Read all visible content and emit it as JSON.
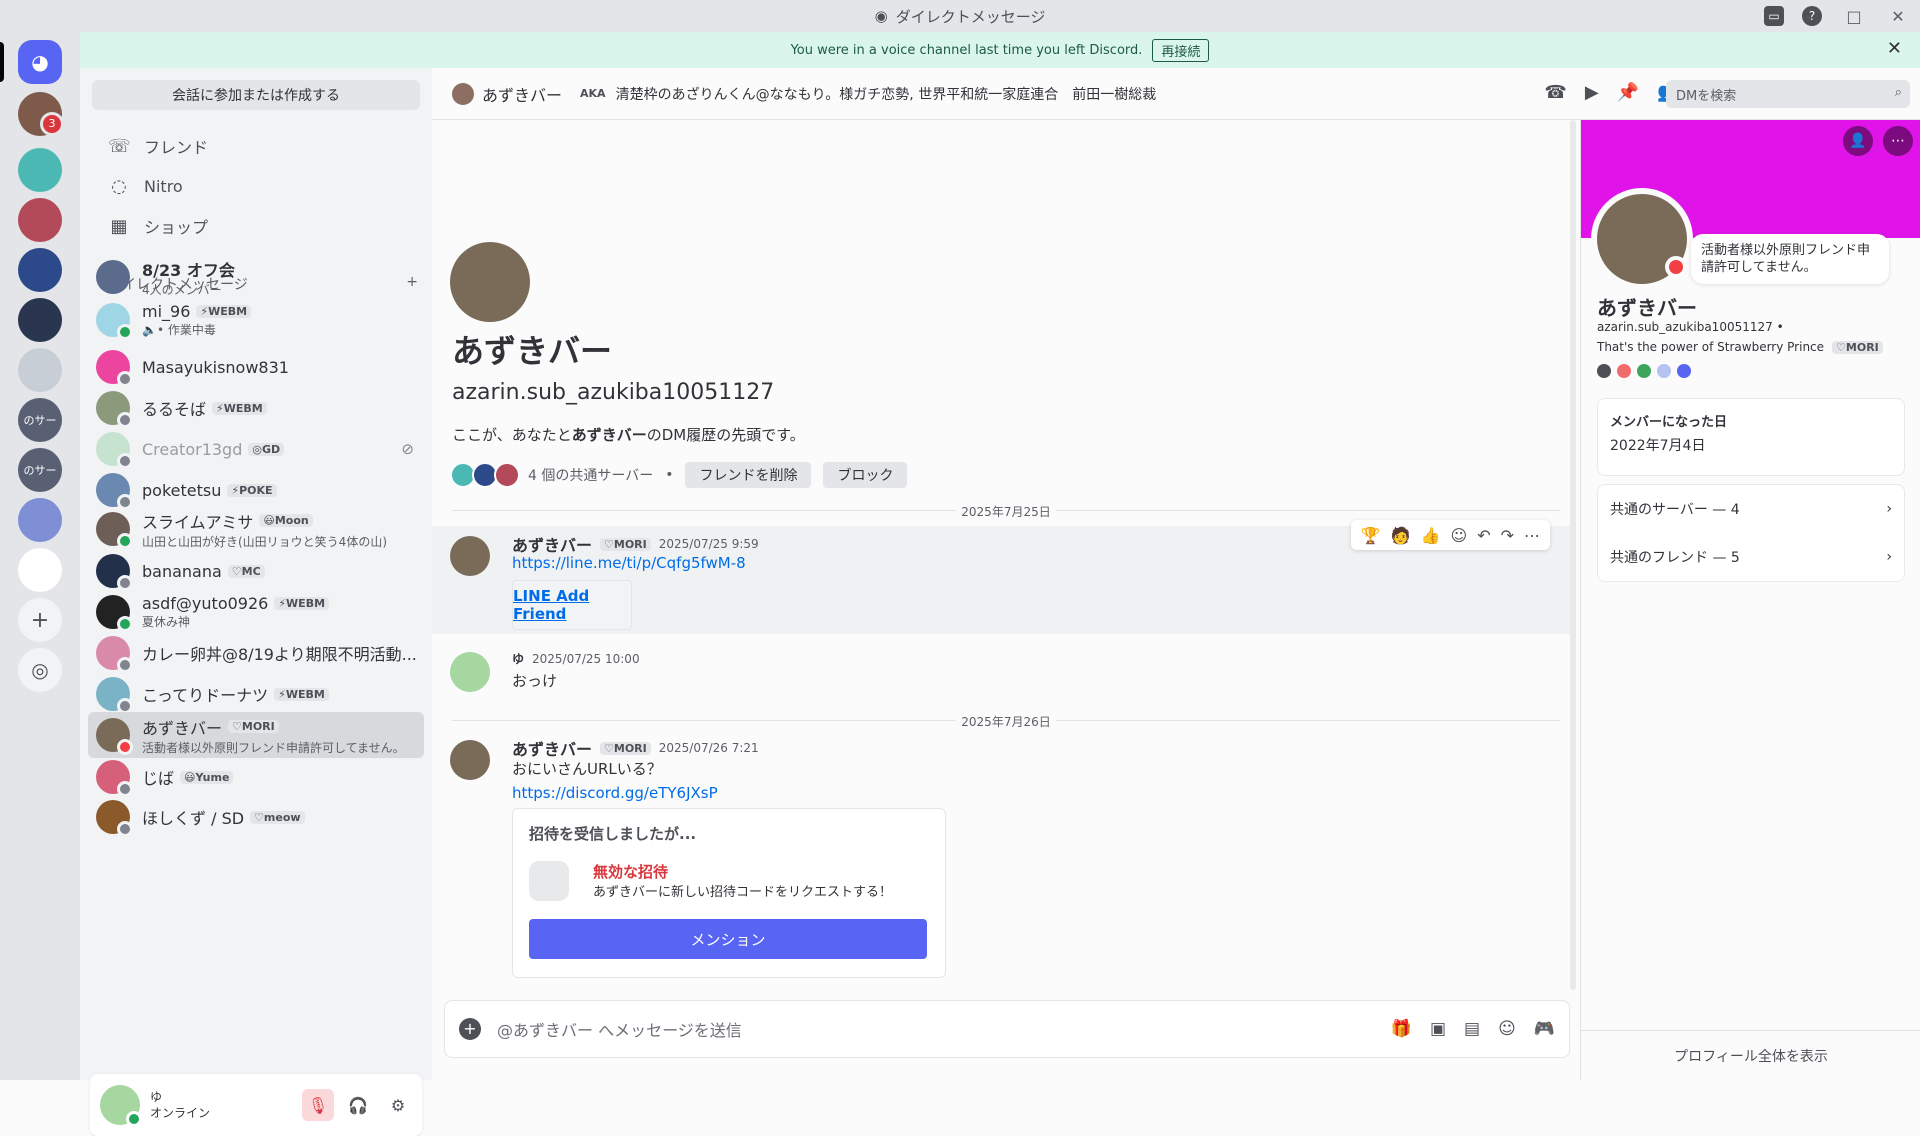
{
  "window": {
    "title": "ダイレクトメッセージ"
  },
  "banner": {
    "text": "You were in a voice channel last time you left Discord.",
    "reconnect": "再接続"
  },
  "sidebar": {
    "search_placeholder": "会話に参加または作成する",
    "nav": [
      {
        "label": "フレンド",
        "icon": "friends-icon"
      },
      {
        "label": "Nitro",
        "icon": "nitro-icon"
      },
      {
        "label": "ショップ",
        "icon": "shop-icon"
      }
    ],
    "dm_header": "ダイレクトメッセージ",
    "dms": [
      {
        "name": "8/23 オフ会",
        "sub": "4人のメンバー",
        "tag": "",
        "status": "",
        "color": "#5b6b8c"
      },
      {
        "name": "mi_96",
        "sub": "🔈• 作業中毒",
        "tag": "⚡WEBM",
        "status": "on",
        "color": "#9fd6e6"
      },
      {
        "name": "Masayukisnow831",
        "sub": "",
        "tag": "",
        "status": "off",
        "color": "#eb459f"
      },
      {
        "name": "るるそば",
        "sub": "",
        "tag": "⚡WEBM",
        "status": "off",
        "color": "#8b9a7a"
      },
      {
        "name": "Creator13gd",
        "sub": "",
        "tag": "◎GD",
        "status": "off",
        "color": "#c6e3cf"
      },
      {
        "name": "poketetsu",
        "sub": "",
        "tag": "⚡POKE",
        "status": "off",
        "color": "#6a88b0"
      },
      {
        "name": "スライムアミサ",
        "sub": "山田と山田が好き(山田リョウと笑う4体の山)",
        "tag": "😃Moon",
        "status": "on",
        "color": "#6d5e58"
      },
      {
        "name": "bananana",
        "sub": "",
        "tag": "♡MC",
        "status": "off",
        "color": "#23304a"
      },
      {
        "name": "asdf@yuto0926",
        "sub": "夏休み神",
        "tag": "⚡WEBM",
        "status": "on",
        "color": "#222222"
      },
      {
        "name": "カレー卵丼@8/19より期限不明活動...",
        "sub": "",
        "tag": "",
        "status": "off",
        "color": "#d98aa8"
      },
      {
        "name": "こってりドーナツ",
        "sub": "",
        "tag": "⚡WEBM",
        "status": "off",
        "color": "#7ab3c6"
      },
      {
        "name": "あずきバー",
        "sub": "活動者様以外原則フレンド申請許可してません。",
        "tag": "♡MORI",
        "status": "dnd",
        "color": "#7a6a58"
      },
      {
        "name": "じば",
        "sub": "",
        "tag": "😃Yume",
        "status": "off",
        "color": "#d6607a"
      },
      {
        "name": "ほしくず / SD",
        "sub": "",
        "tag": "♡meow",
        "status": "off",
        "color": "#8a5a2a"
      }
    ]
  },
  "user_panel": {
    "name": "ゆ",
    "status": "オンライン"
  },
  "header": {
    "name": "あずきバー",
    "aka_label": "AKA",
    "aka_list": "清楚枠のあざりんくん@ななもり。様ガチ恋勢, 世界平和統一家庭連合　前田一樹総裁",
    "search_placeholder": "DMを検索"
  },
  "intro": {
    "name": "あずきバー",
    "username": "azarin.sub_azukiba10051127",
    "desc_prefix": "ここが、あなたと",
    "desc_name": "あずきバー",
    "desc_suffix": "のDM履歴の先頭です。",
    "mutual": "4 個の共通サーバー",
    "remove_friend": "フレンドを削除",
    "block": "ブロック"
  },
  "messages": {
    "date1": "2025年7月25日",
    "m1": {
      "author": "あずきバー",
      "tag": "♡MORI",
      "time": "2025/07/25 9:59",
      "link": "https://line.me/ti/p/Cqfg5fwM-8",
      "embed": "LINE Add Friend"
    },
    "m2": {
      "author": "ゆ",
      "time": "2025/07/25 10:00",
      "text": "おっけ"
    },
    "date2": "2025年7月26日",
    "m3": {
      "author": "あずきバー",
      "tag": "♡MORI",
      "time": "2025/07/26 7:21",
      "text": "おにいさんURLいる？",
      "link": "https://discord.gg/eTY6JXsP"
    },
    "invite": {
      "title": "招待を受信しましたが...",
      "invalid": "無効な招待",
      "sub": "あずきバーに新しい招待コードをリクエストする！",
      "button": "メンション"
    }
  },
  "composer": {
    "placeholder": "@あずきバー へメッセージを送信"
  },
  "profile": {
    "bubble": "活動者様以外原則フレンド申請許可してません。",
    "name": "あずきバー",
    "username": "azarin.sub_azukiba10051127 •",
    "status_text": "That's the power of Strawberry Prince",
    "tag": "♡MORI",
    "member_since_label": "メンバーになった日",
    "member_since": "2022年7月4日",
    "mutual_servers": "共通のサーバー — 4",
    "mutual_friends": "共通のフレンド — 5",
    "view_full": "プロフィール全体を表示"
  },
  "colors": {
    "accent": "#5865f2",
    "banner": "#e014e8",
    "link": "#006ce7",
    "danger": "#da373c"
  }
}
